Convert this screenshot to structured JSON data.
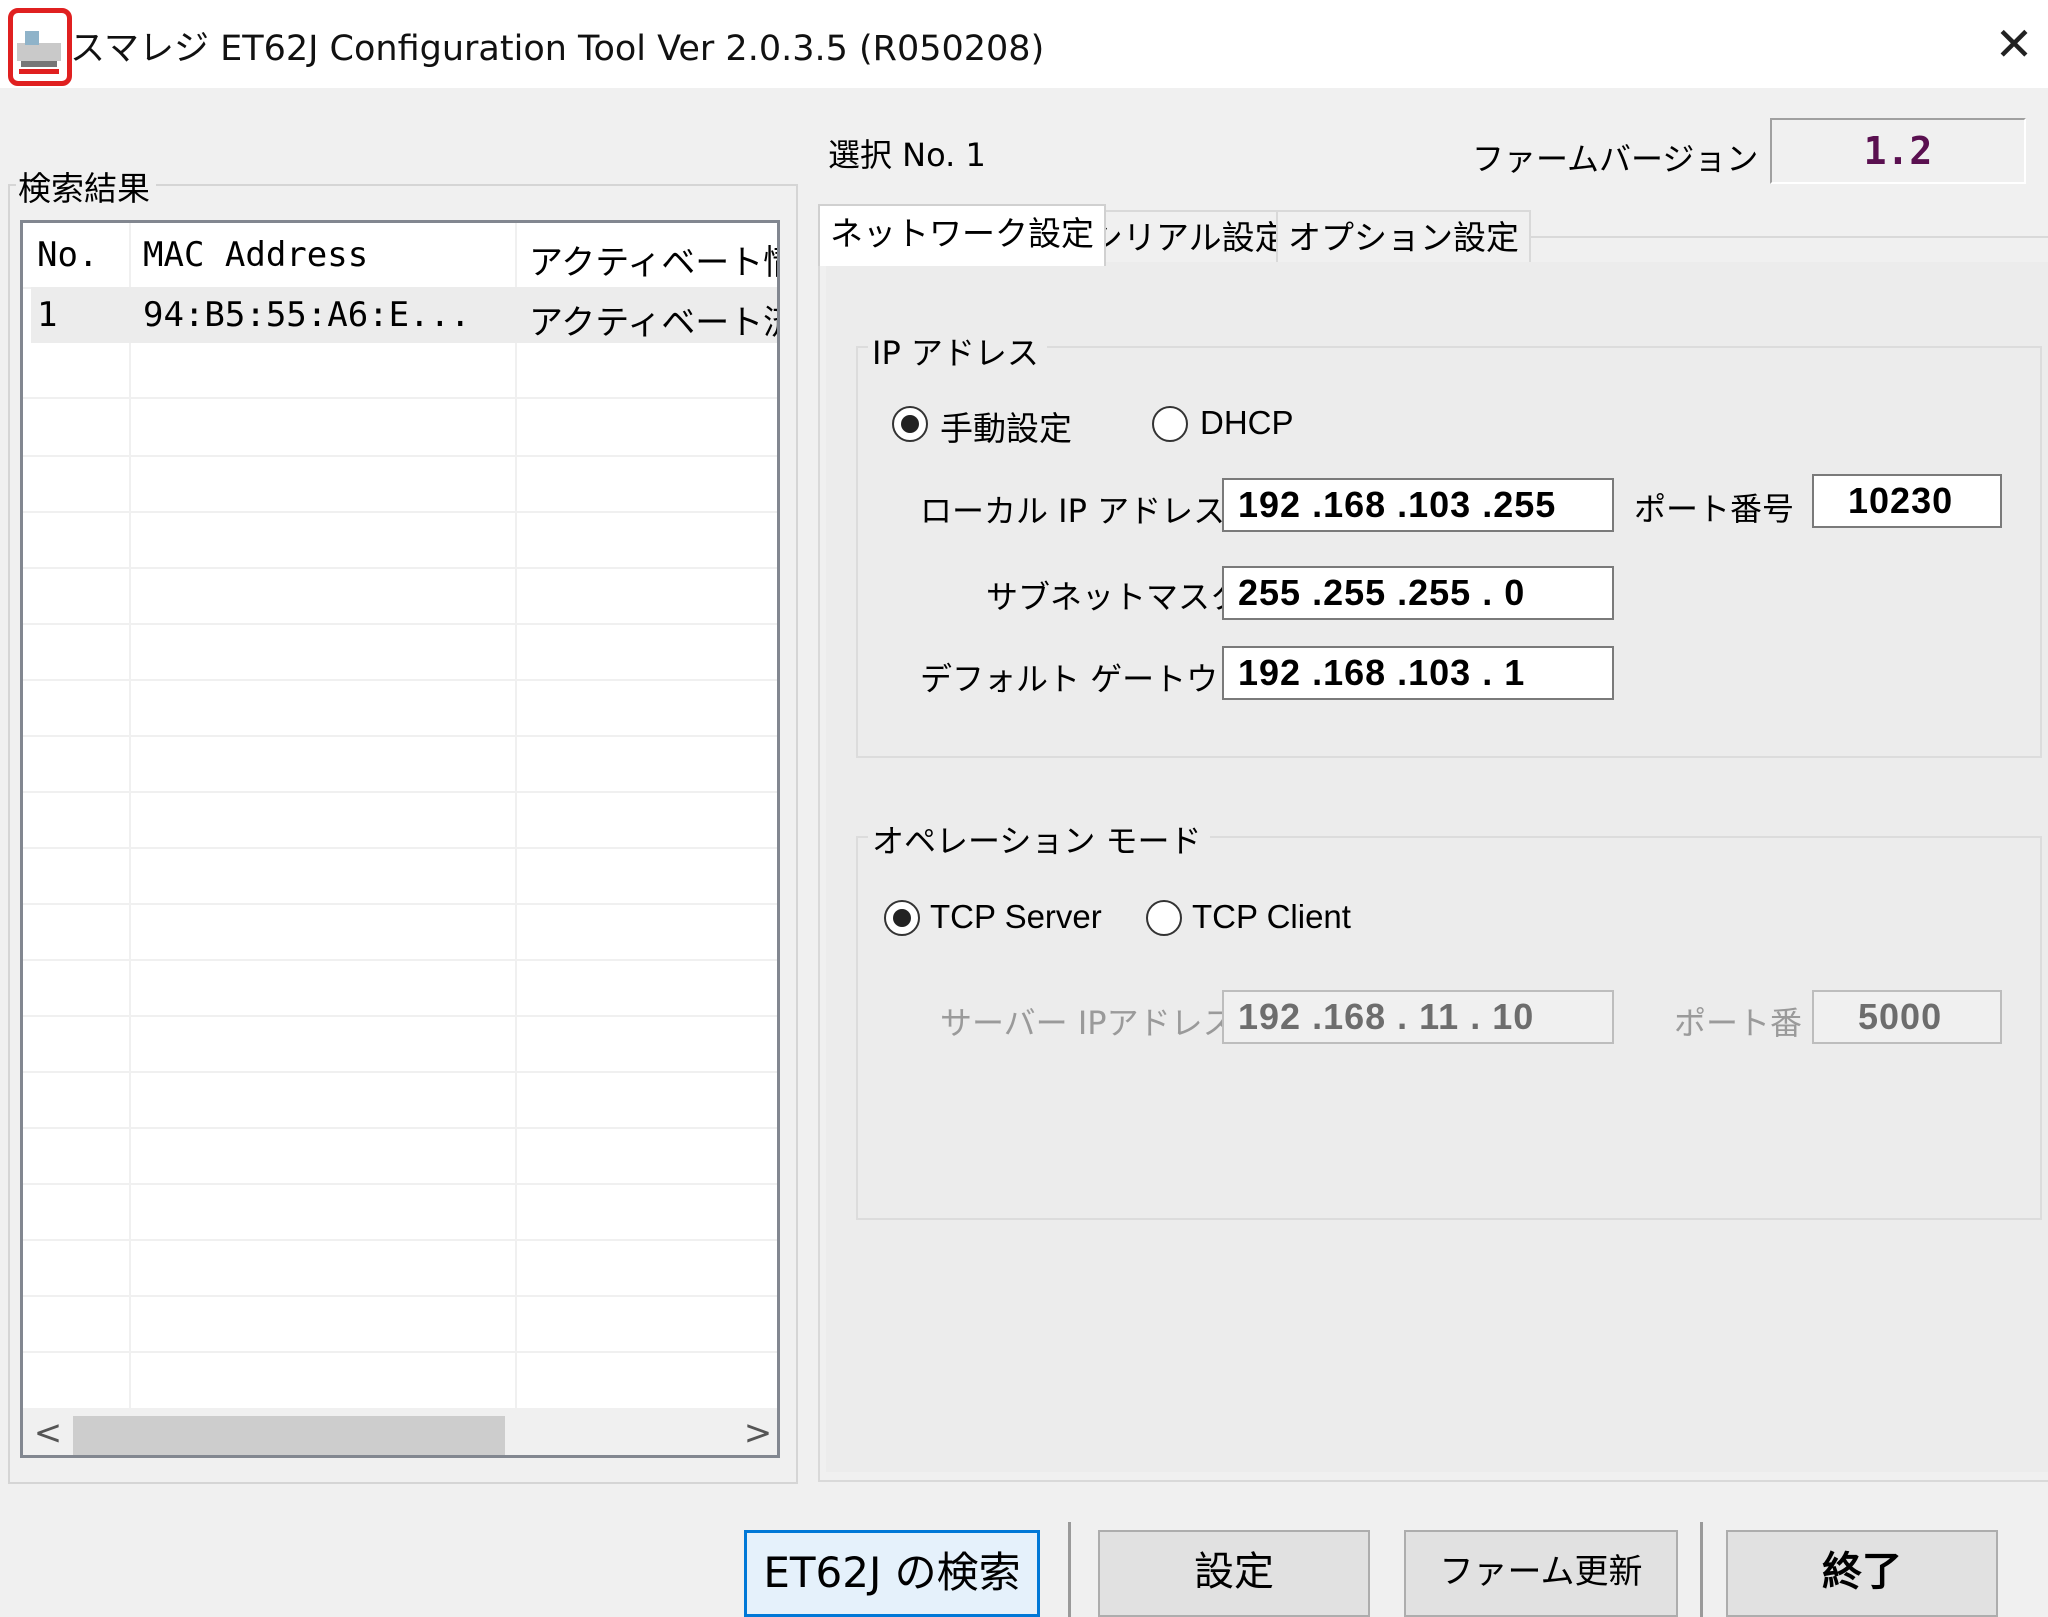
{
  "window": {
    "title": "スマレジ ET62J Configuration Tool  Ver 2.0.3.5 (R050208)",
    "close_glyph": "✕",
    "icon": "app-icon"
  },
  "results": {
    "legend": "検索結果",
    "columns": [
      "No.",
      "MAC Address",
      "アクティベート情報"
    ],
    "rows": [
      {
        "no": "1",
        "mac": "94:B5:55:A6:E...",
        "status": "アクティベート済み"
      }
    ],
    "scroll_left": "<",
    "scroll_right": ">"
  },
  "header": {
    "selection": "選択 No. 1",
    "firmware_label": "ファームバージョン",
    "firmware_version": "1.2"
  },
  "tabs": [
    "ネットワーク設定",
    "シリアル設定",
    "オプション設定"
  ],
  "ip_group": {
    "legend": "IP アドレス",
    "mode_manual": "手動設定",
    "mode_dhcp": "DHCP",
    "selected_mode": "手動設定",
    "local_ip_label": "ローカル IP アドレス",
    "local_ip": "192 .168 .103 .255",
    "port_label": "ポート番号",
    "port": "10230",
    "subnet_label": "サブネットマスク",
    "subnet": "255 .255 .255 .  0",
    "gateway_label": "デフォルト ゲートウェ",
    "gateway": "192 .168 .103 .  1"
  },
  "op_group": {
    "legend": "オペレーション モード",
    "mode_server": "TCP Server",
    "mode_client": "TCP Client",
    "selected_mode": "TCP Server",
    "server_ip_label": "サーバー IPアドレス",
    "server_ip": "192 .168 . 11  . 10",
    "server_port_label": "ポート番",
    "server_port": "5000"
  },
  "buttons": {
    "search": "ET62J の検索",
    "set": "設定",
    "firmware_update": "ファーム更新",
    "exit": "終了"
  },
  "colors": {
    "accent": "#0078d7",
    "firmware_text": "#5a1050",
    "icon_border": "#e02020"
  }
}
